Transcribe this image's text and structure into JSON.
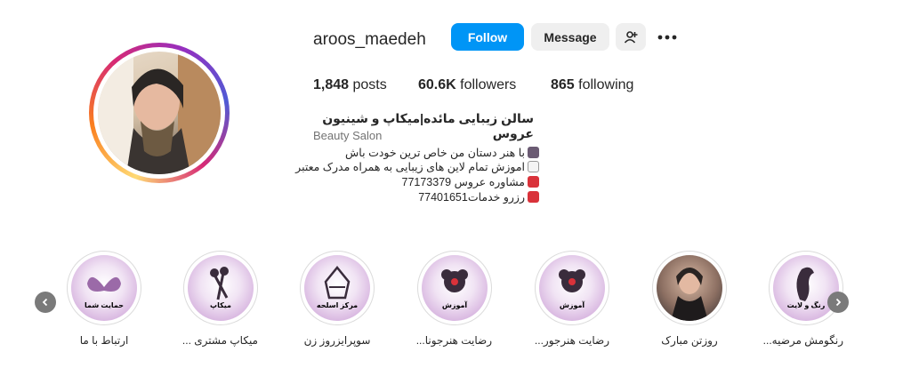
{
  "profile": {
    "username": "aroos_maedeh",
    "follow_label": "Follow",
    "message_label": "Message",
    "posts_count": "1,848",
    "posts_label": "posts",
    "followers_count": "60.6K",
    "followers_label": "followers",
    "following_count": "865",
    "following_label": "following",
    "bio_name": "سالن زیبایی مائده|میکاپ و شینیون عروس",
    "category": "Beauty Salon",
    "bio_lines": [
      {
        "icon": "woman-technologist-emoji",
        "text": "با هنر دستان من خاص ترین خودت باش"
      },
      {
        "icon": "memo-emoji",
        "text": "اموزش تمام لاین های زیبایی به همراه مدرک معتبر"
      },
      {
        "icon": "telephone-emoji",
        "text": "مشاوره عروس 77173379"
      },
      {
        "icon": "telephone-emoji",
        "text": "رزرو خدمات77401651"
      }
    ]
  },
  "highlights": [
    {
      "label": "ارتباط با ما",
      "caption": "حمایت شما"
    },
    {
      "label": "میکاپ مشتری ...",
      "caption": "میکاپ"
    },
    {
      "label": "سوپرایزروز زن",
      "caption": "مرکز اسلحه"
    },
    {
      "label": "رضایت هنرجونا...",
      "caption": "آموزش"
    },
    {
      "label": "رضایت هنرجور...",
      "caption": "آموزش"
    },
    {
      "label": "روزتن مبارک",
      "caption": ""
    },
    {
      "label": "رنگومش مرضیه...",
      "caption": "رنگ و لایت"
    }
  ],
  "colors": {
    "follow_button": "#0095f6",
    "secondary_button": "#efefef",
    "text": "#262626",
    "muted": "#737373"
  }
}
